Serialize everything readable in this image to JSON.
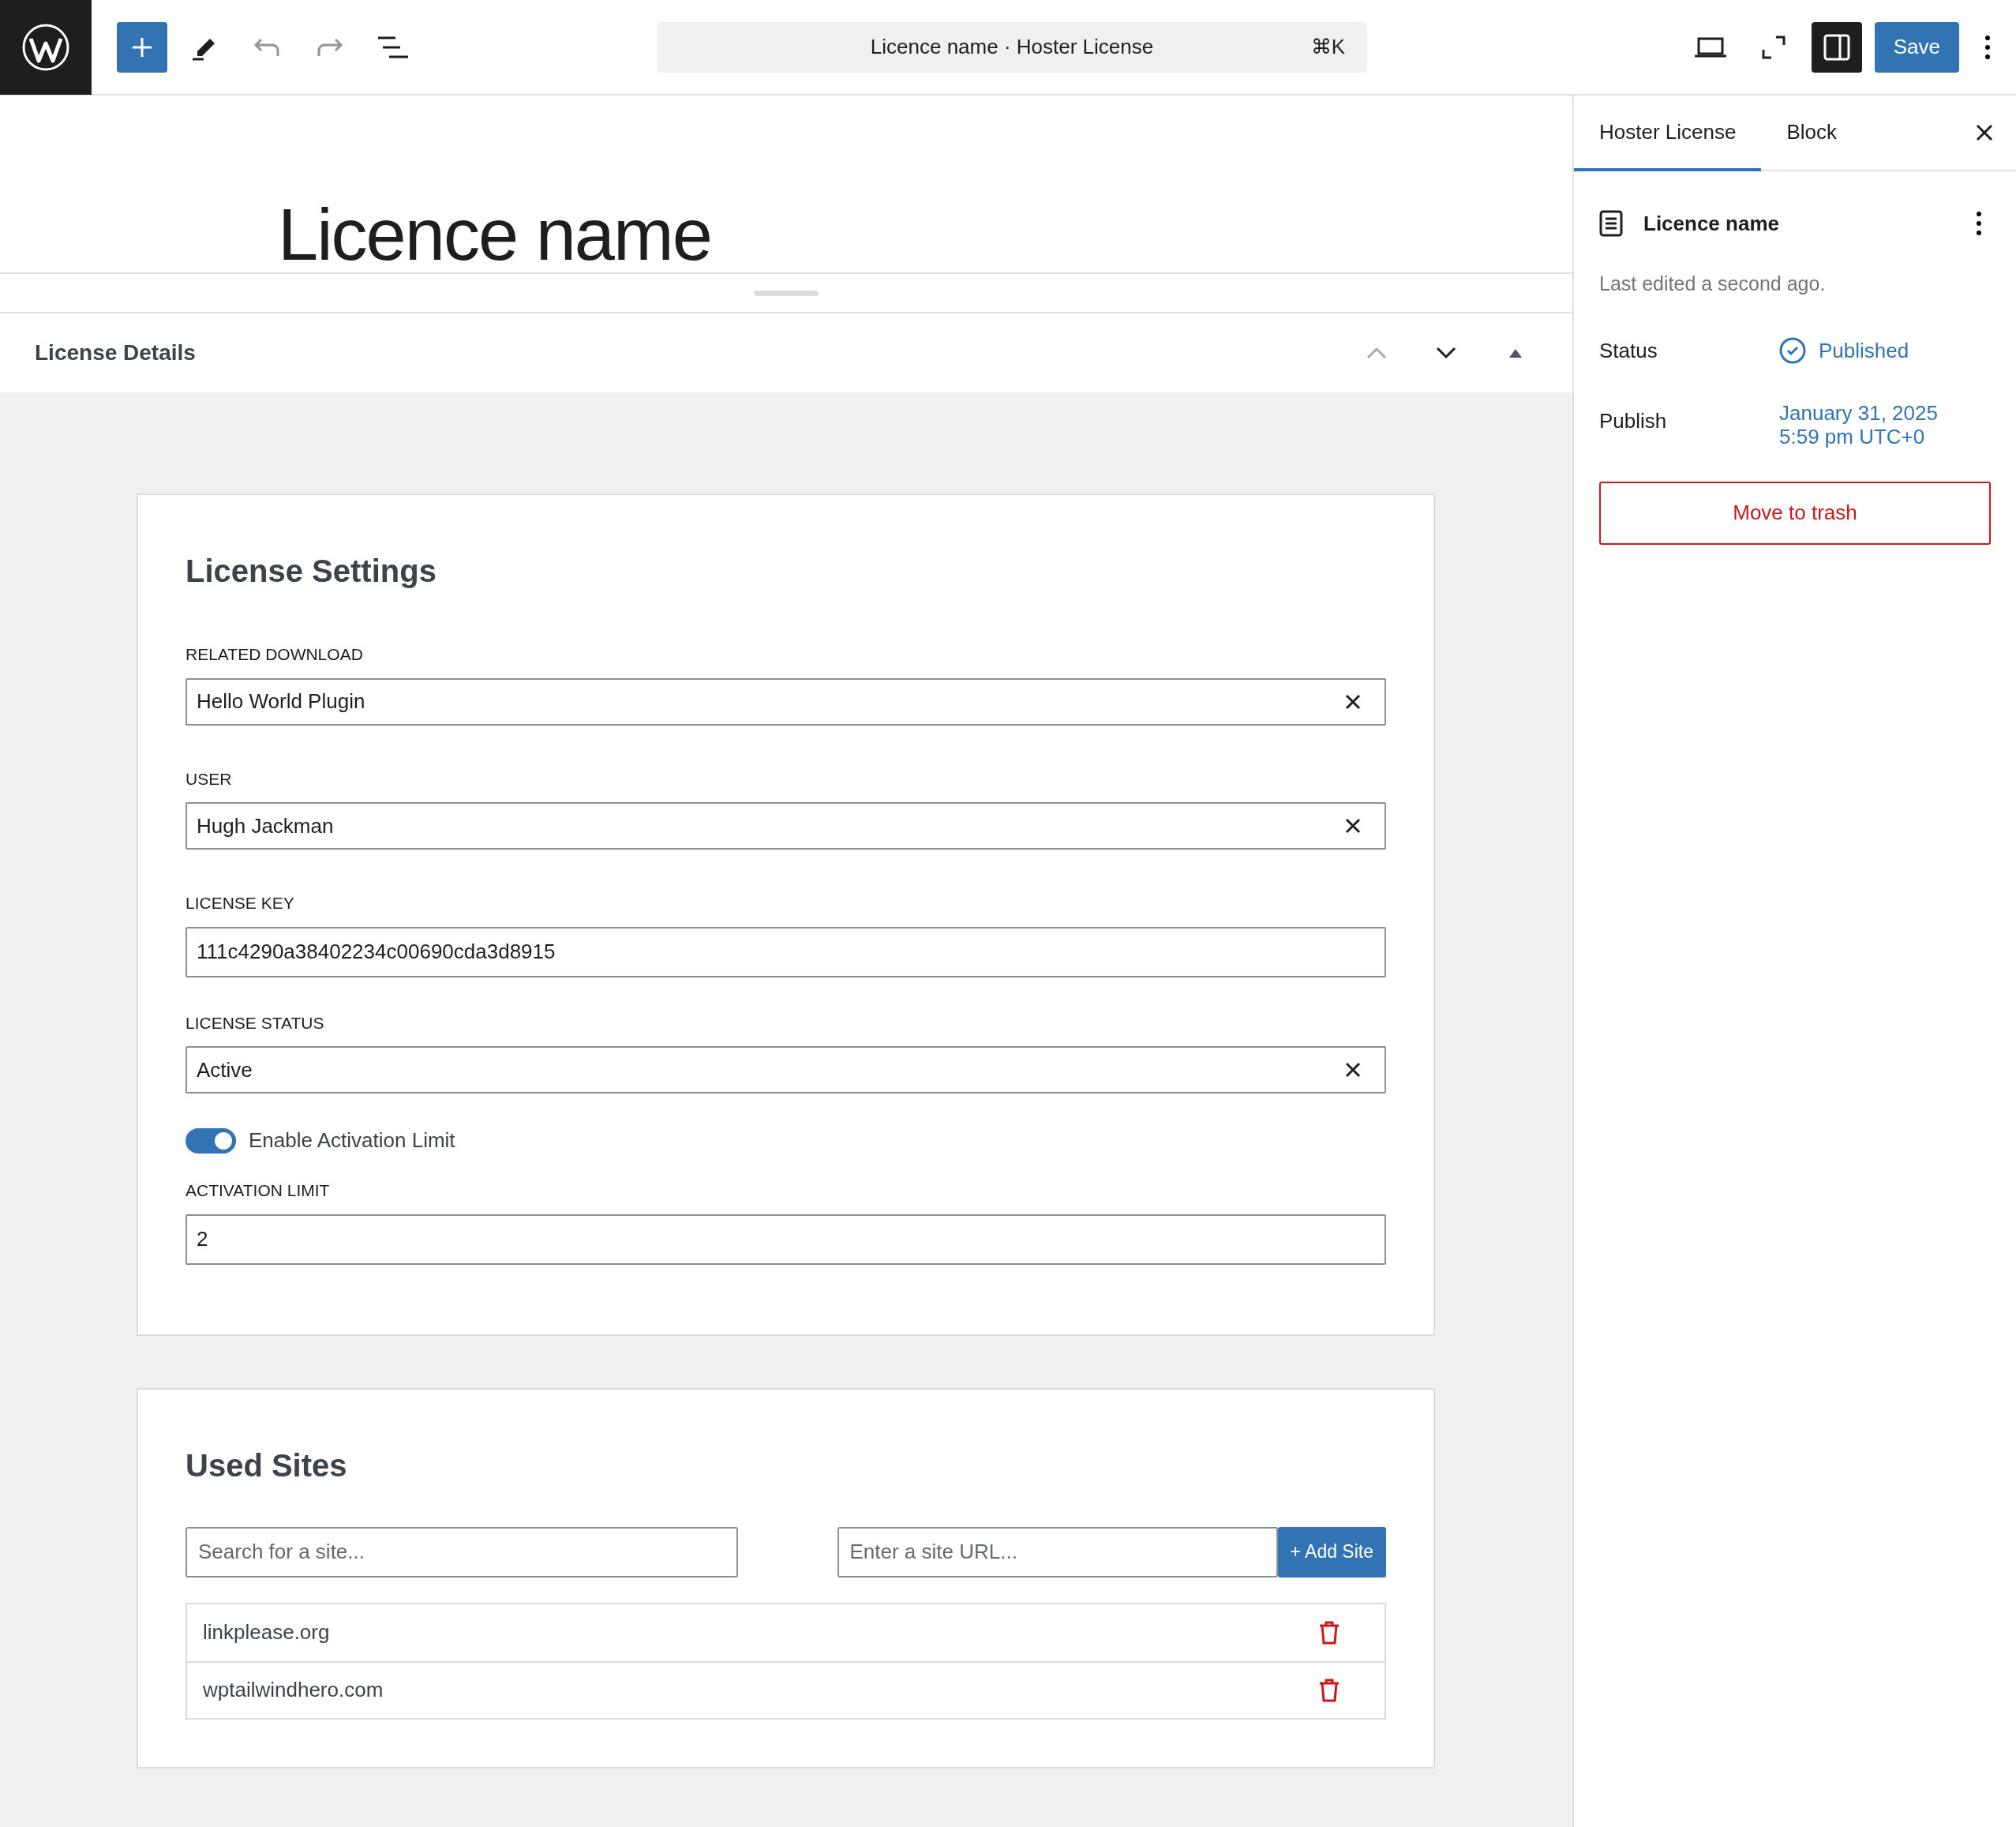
{
  "toolbar": {
    "command_bar": {
      "title": "Licence name · Hoster License",
      "shortcut": "⌘K"
    },
    "save": "Save"
  },
  "post_title": "Licence name",
  "meta_box": {
    "title": "License Details"
  },
  "license_settings": {
    "heading": "License Settings",
    "fields": [
      {
        "kind": "select",
        "label": "RELATED DOWNLOAD",
        "value": "Hello World Plugin"
      },
      {
        "kind": "select",
        "label": "USER",
        "value": "Hugh Jackman"
      },
      {
        "kind": "text",
        "label": "LICENSE KEY",
        "value": "111c4290a38402234c00690cda3d8915"
      },
      {
        "kind": "select",
        "label": "LICENSE STATUS",
        "value": "Active"
      },
      {
        "kind": "toggle",
        "label": "Enable Activation Limit",
        "on": true
      },
      {
        "kind": "text",
        "label": "ACTIVATION LIMIT",
        "value": "2"
      }
    ]
  },
  "used_sites": {
    "heading": "Used Sites",
    "search": {
      "placeholder": "Search for a site..."
    },
    "new_site": {
      "placeholder": "Enter a site URL..."
    },
    "add_button": "+ Add Site",
    "sites": [
      "linkplease.org",
      "wptailwindhero.com"
    ]
  },
  "sidebar": {
    "tabs": [
      {
        "label": "Hoster License",
        "selected": true
      },
      {
        "label": "Block",
        "selected": false
      }
    ],
    "document_title": "Licence name",
    "last_edited": "Last edited a second ago.",
    "status": {
      "label": "Status",
      "value": "Published"
    },
    "publish": {
      "label": "Publish",
      "date": "January 31, 2025",
      "time": "5:59 pm UTC+0"
    },
    "trash_button": "Move to trash"
  }
}
